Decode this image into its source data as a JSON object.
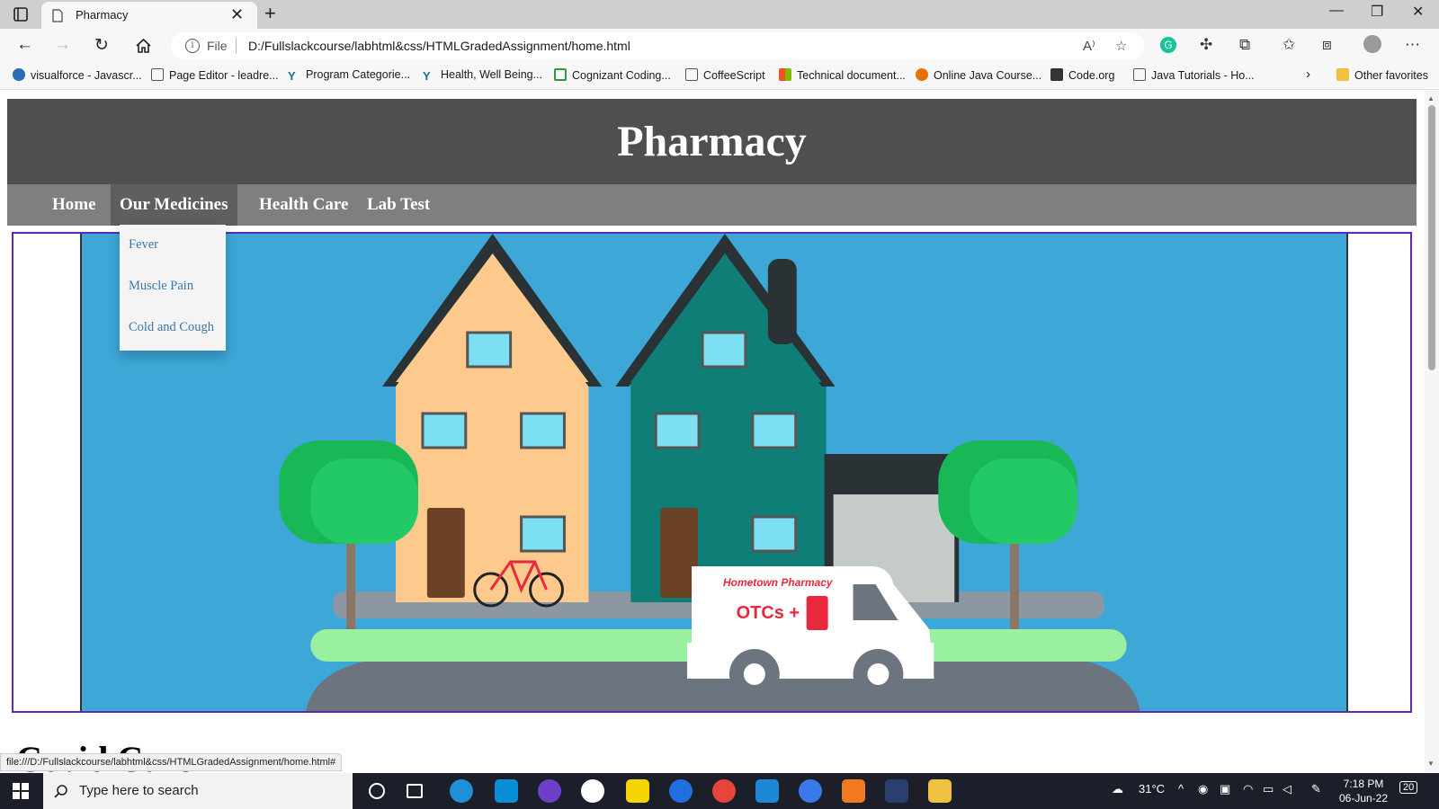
{
  "browser": {
    "tab_title": "Pharmacy",
    "address_prefix": "File",
    "url": "D:/Fullslackcourse/labhtml&css/HTMLGradedAssignment/home.html"
  },
  "bookmarks": [
    {
      "label": "visualforce - Javascr...",
      "icon": "cloud-icon",
      "color": "#2b6cb0"
    },
    {
      "label": "Page Editor - leadre...",
      "icon": "page-icon",
      "color": "#555555"
    },
    {
      "label": "Program Categorie...",
      "icon": "y-icon",
      "color": "#1f6f8b"
    },
    {
      "label": "Health, Well Being...",
      "icon": "y-icon",
      "color": "#1f6f8b"
    },
    {
      "label": "Cognizant Coding...",
      "icon": "cognizant-icon",
      "color": "#2e9a44"
    },
    {
      "label": "CoffeeScript",
      "icon": "page-icon",
      "color": "#555555"
    },
    {
      "label": "Technical document...",
      "icon": "microsoft-icon",
      "color": "#f25022"
    },
    {
      "label": "Online Java Course...",
      "icon": "java-icon",
      "color": "#e76f00"
    },
    {
      "label": "Code.org",
      "icon": "grid-icon",
      "color": "#333333"
    },
    {
      "label": "Java Tutorials - Ho...",
      "icon": "page-icon",
      "color": "#555555"
    }
  ],
  "other_favorites": "Other favorites",
  "site": {
    "title": "Pharmacy",
    "nav": [
      "Home",
      "Our Medicines",
      "Health Care",
      "Lab Test"
    ],
    "active_nav": "Our Medicines",
    "dropdown": [
      "Fever",
      "Muscle Pain",
      "Cold and Cough"
    ],
    "van_brand": "Hometown Pharmacy",
    "van_text": "OTCs +",
    "section_heading": "Covid Care"
  },
  "status_link": "file:///D:/Fullslackcourse/labhtml&css/HTMLGradedAssignment/home.html#",
  "taskbar": {
    "search_placeholder": "Type here to search",
    "temperature": "31°C",
    "time": "7:18 PM",
    "date": "06-Jun-22",
    "notifications": "20"
  },
  "colors": {
    "header_bg": "#4f4f4f",
    "nav_bg": "#7f7f7f",
    "nav_active": "#5f5f5f",
    "sky": "#3da8d8",
    "banner_border": "#5b2bb8"
  }
}
